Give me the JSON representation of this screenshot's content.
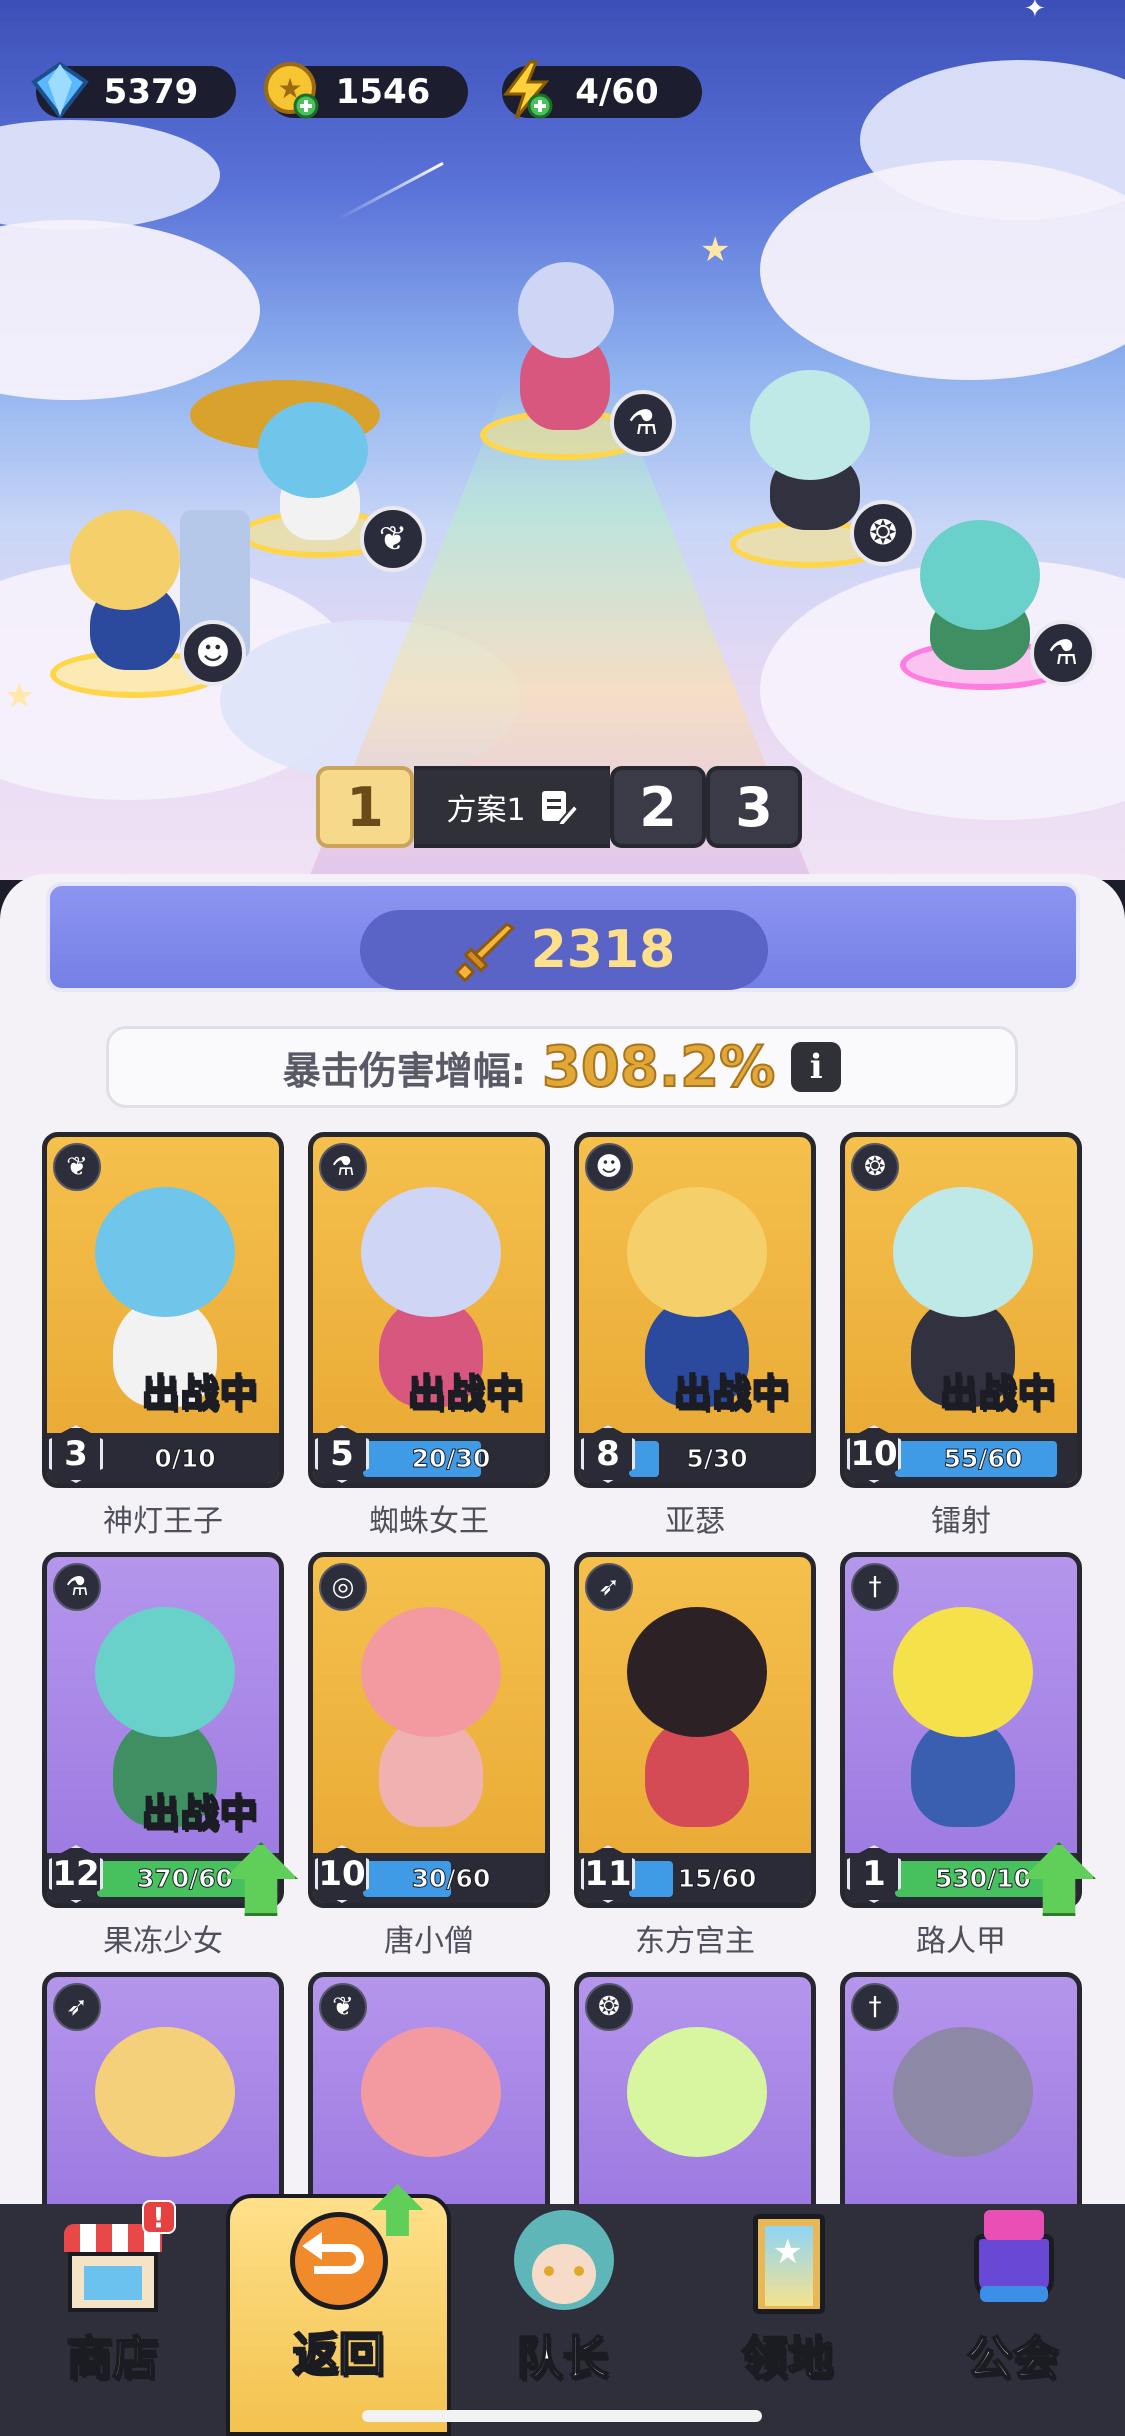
{
  "resources": {
    "diamonds": "5379",
    "gold": "1546",
    "energy": "4/60"
  },
  "schemes": {
    "tabs": [
      "1",
      "2",
      "3"
    ],
    "active_name": "方案1"
  },
  "power": "2318",
  "crit": {
    "label": "暴击伤害增幅:",
    "value": "308.2%",
    "info": "i"
  },
  "deployed_label": {
    "a": "出",
    "b": "战中"
  },
  "heroes": [
    {
      "name": "神灯王子",
      "level": "3",
      "progress": "0/10",
      "fill": 0.0,
      "bar": "blue",
      "deployed": true,
      "upgrade": false,
      "class_icon": "wing-icon",
      "card": "gold"
    },
    {
      "name": "蜘蛛女王",
      "level": "5",
      "progress": "20/30",
      "fill": 0.67,
      "bar": "blue",
      "deployed": true,
      "upgrade": false,
      "class_icon": "potion-icon",
      "card": "gold"
    },
    {
      "name": "亚瑟",
      "level": "8",
      "progress": "5/30",
      "fill": 0.17,
      "bar": "blue",
      "deployed": true,
      "upgrade": false,
      "class_icon": "demon-icon",
      "card": "gold"
    },
    {
      "name": "镭射",
      "level": "10",
      "progress": "55/60",
      "fill": 0.92,
      "bar": "blue",
      "deployed": true,
      "upgrade": false,
      "class_icon": "staff-icon",
      "card": "gold"
    },
    {
      "name": "果冻少女",
      "level": "12",
      "progress": "370/60",
      "fill": 1.0,
      "bar": "green",
      "deployed": true,
      "upgrade": true,
      "class_icon": "potion-icon",
      "card": "purple"
    },
    {
      "name": "唐小僧",
      "level": "10",
      "progress": "30/60",
      "fill": 0.5,
      "bar": "blue",
      "deployed": false,
      "upgrade": false,
      "class_icon": "swirl-icon",
      "card": "gold"
    },
    {
      "name": "东方宫主",
      "level": "11",
      "progress": "15/60",
      "fill": 0.25,
      "bar": "blue",
      "deployed": false,
      "upgrade": false,
      "class_icon": "bow-icon",
      "card": "gold"
    },
    {
      "name": "路人甲",
      "level": "1",
      "progress": "530/10",
      "fill": 1.0,
      "bar": "green",
      "deployed": false,
      "upgrade": true,
      "class_icon": "sword-icon",
      "card": "purple"
    }
  ],
  "partial_row_icons": [
    "bow-icon",
    "wing-icon",
    "staff-icon",
    "sword-icon"
  ],
  "nav": [
    {
      "label": "商店",
      "icon": "shop-icon"
    },
    {
      "label": "返回",
      "icon": "return-icon"
    },
    {
      "label": "队长",
      "icon": "captain-icon"
    },
    {
      "label": "领地",
      "icon": "territory-icon"
    },
    {
      "label": "公会",
      "icon": "guild-icon"
    }
  ],
  "nav_badge": "!"
}
